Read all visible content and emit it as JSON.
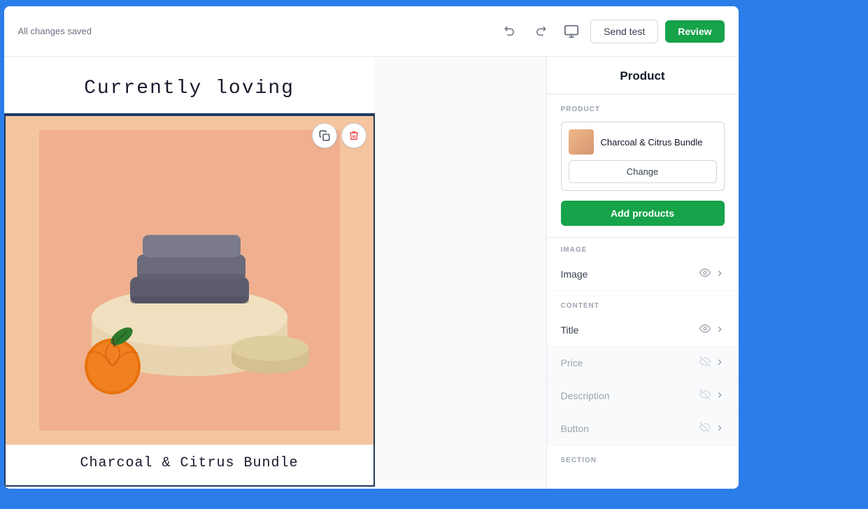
{
  "topbar": {
    "status": "All changes saved",
    "send_test_label": "Send test",
    "review_label": "Review",
    "undo_icon": "↩",
    "redo_icon": "↪",
    "monitor_icon": "⬛"
  },
  "email": {
    "header_title": "Currently loving",
    "product_name": "Charcoal & Citrus Bundle"
  },
  "right_panel": {
    "title": "Product",
    "product_section_label": "PRODUCT",
    "product_name": "Charcoal & Citrus Bundle",
    "change_label": "Change",
    "add_products_label": "Add products",
    "image_section_label": "IMAGE",
    "image_row_label": "Image",
    "content_section_label": "CONTENT",
    "title_row_label": "Title",
    "price_row_label": "Price",
    "description_row_label": "Description",
    "button_row_label": "Button",
    "section_label": "SECTION"
  },
  "colors": {
    "green": "#16a34a",
    "navy": "#1e3a5f",
    "peach_bg": "#f5c5a0"
  }
}
